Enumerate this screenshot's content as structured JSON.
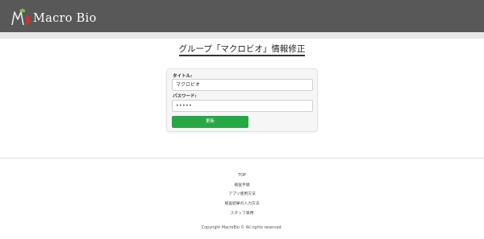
{
  "header": {
    "brand": "Macro Bio",
    "logo_mark": "MB",
    "logo_icon": "macrobio-leaf-logo-icon"
  },
  "page": {
    "title": "グループ「マクロビオ」情報修正"
  },
  "form": {
    "title_label": "タイトル:",
    "title_value": "マクロビオ",
    "password_label": "パスワード:",
    "password_value": "•••••",
    "submit_label": "更新"
  },
  "footer": {
    "links": [
      {
        "label": "TOP"
      },
      {
        "label": "検査手順"
      },
      {
        "label": "アプリ使用方法"
      },
      {
        "label": "検査結果の入力方法"
      },
      {
        "label": "スタッフ専用"
      }
    ],
    "copyright": "Copyright MacroBio © All rights reserved."
  },
  "colors": {
    "header_bg": "#5c5c5c",
    "accent_button": "#28a745",
    "logo_red": "#c0392b",
    "logo_green": "#7cbf3a"
  }
}
